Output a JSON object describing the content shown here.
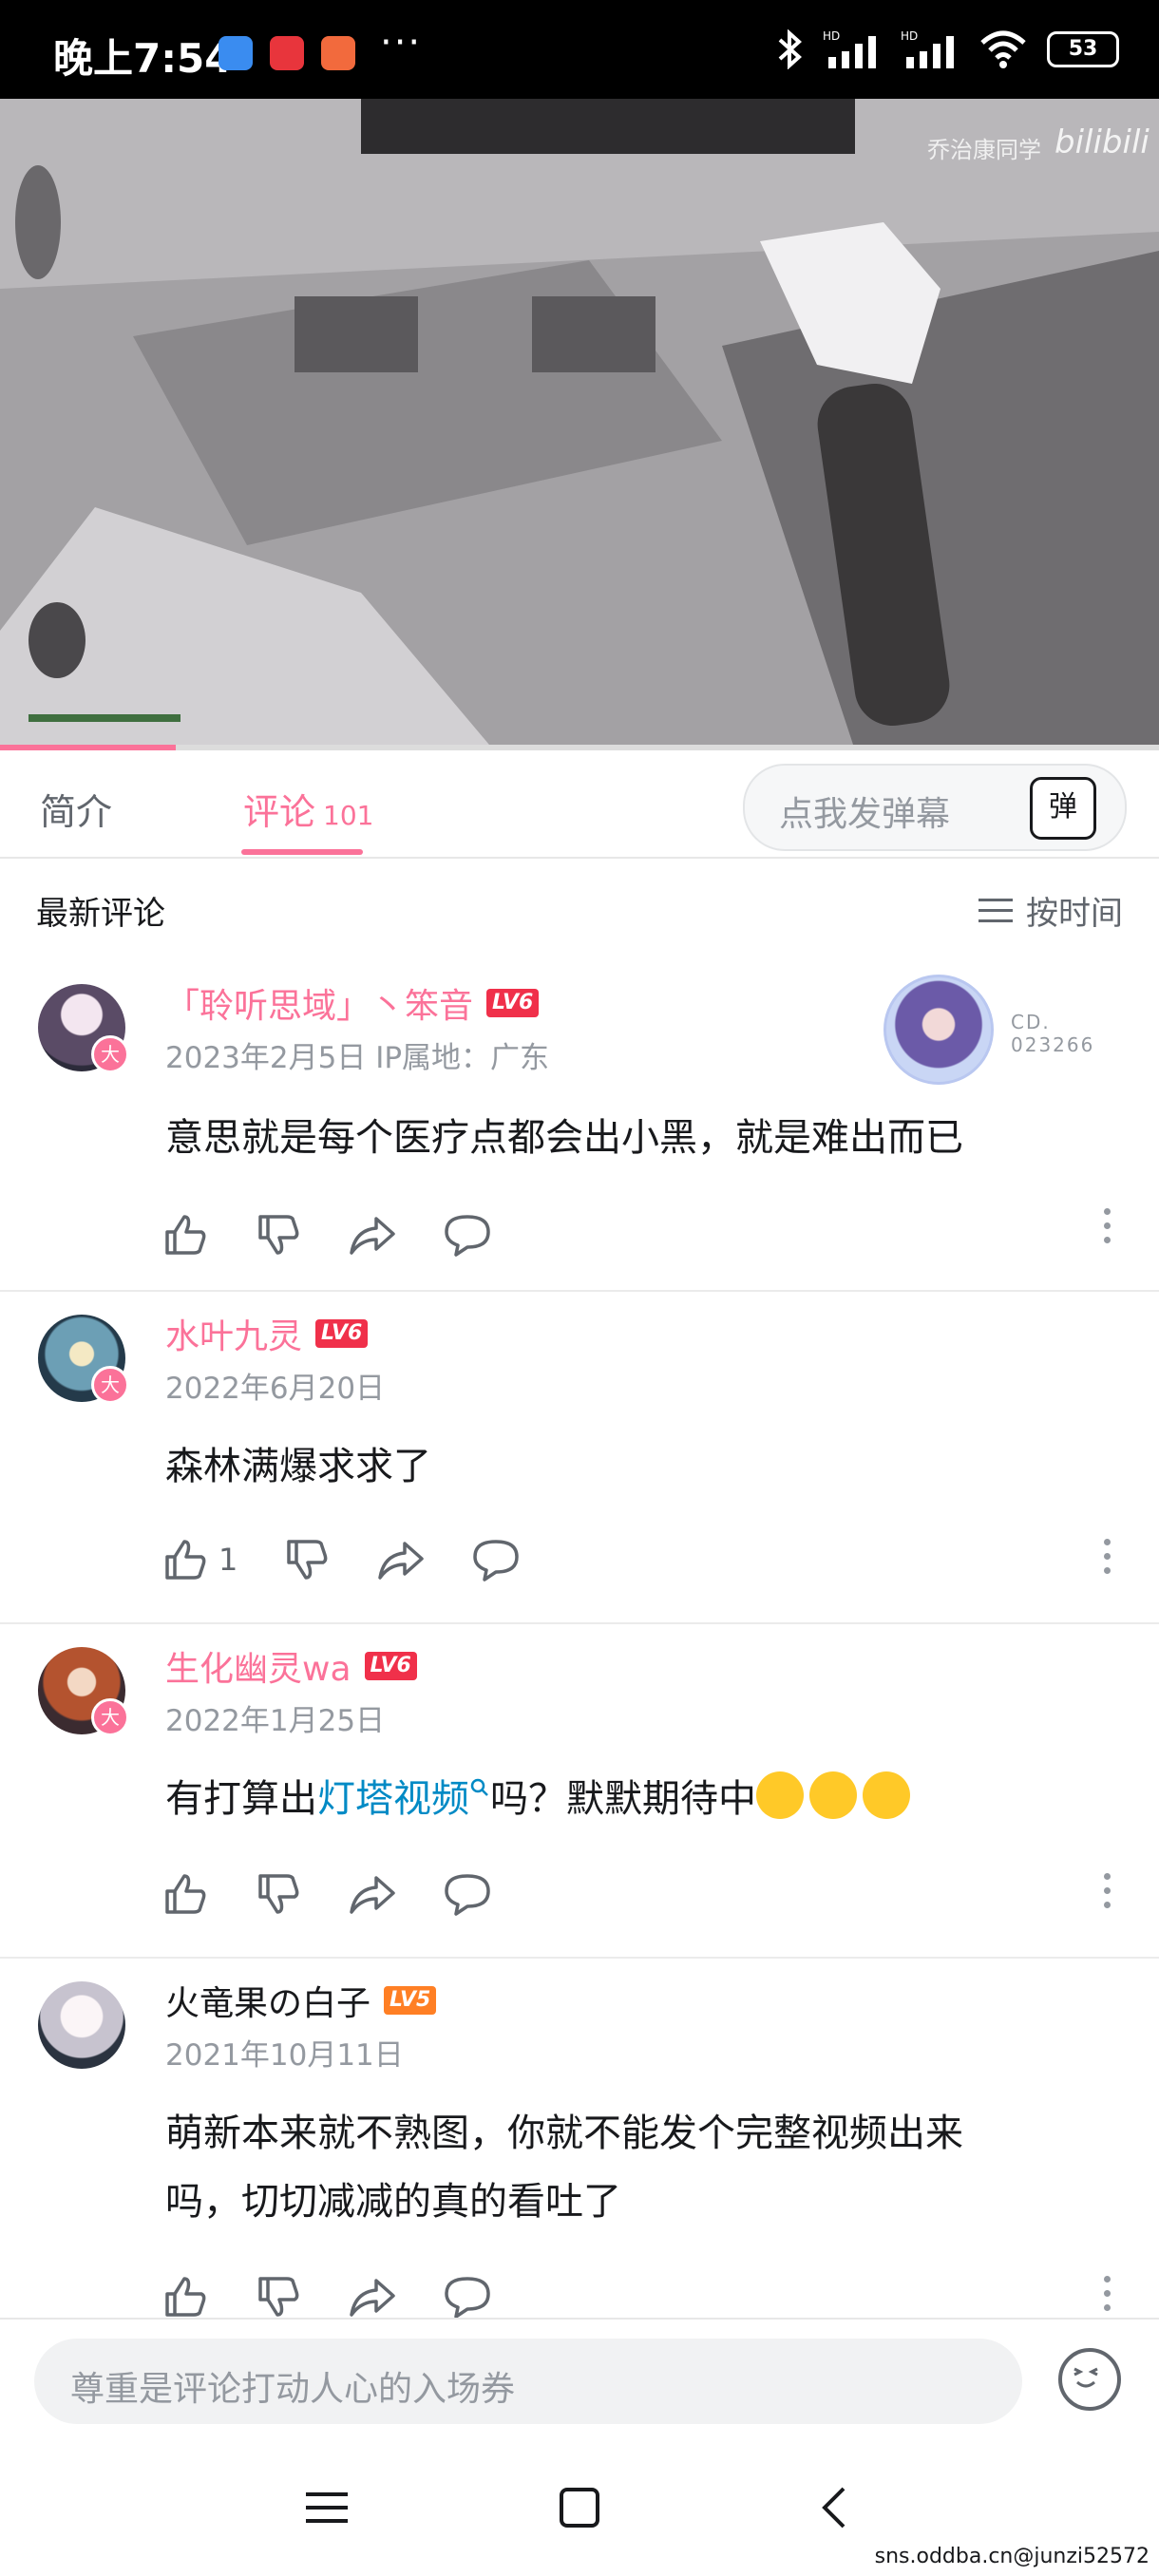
{
  "status_bar": {
    "time": "晚上7:54",
    "more": "···",
    "battery": "53"
  },
  "video": {
    "uploader_watermark": "乔治康同学",
    "site_logo": "bilibili",
    "progress": 0.152
  },
  "tabs": {
    "intro": "简介",
    "comments": "评论",
    "comments_count": "101",
    "danmaku_placeholder": "点我发弹幕",
    "danmaku_icon": "弹"
  },
  "sort": {
    "title": "最新评论",
    "option": "按时间"
  },
  "comments": [
    {
      "username": "「聆听思域」丶笨音",
      "level": "LV6",
      "date": "2023年2月5日 IP属地：广东",
      "text": "意思就是每个医疗点都会出小黑，就是难出而已",
      "likes": "",
      "decor_text_1": "CD.",
      "decor_text_2": "023266"
    },
    {
      "username": "水叶九灵",
      "level": "LV6",
      "date": "2022年6月20日",
      "text": "森林满爆求求了",
      "likes": "1"
    },
    {
      "username": "生化幽灵wa",
      "level": "LV6",
      "date": "2022年1月25日",
      "text_before": "有打算出",
      "text_link": "灯塔视频",
      "text_after": "吗？默默期待中",
      "likes": ""
    },
    {
      "username": "火竜果の白子",
      "level": "LV5",
      "date": "2021年10月11日",
      "text_line1": "萌新本来就不熟图，你就不能发个完整视频出来",
      "text_line2": "吗，切切减减的真的看吐了",
      "likes": ""
    }
  ],
  "comment_input": {
    "placeholder": "尊重是评论打动人心的入场券"
  },
  "watermark": "sns.oddba.cn@junzi52572",
  "colors": {
    "accent": "#fb7299",
    "lv6": "#f0304a",
    "lv5": "#ff7f24",
    "link": "#008ac5"
  }
}
